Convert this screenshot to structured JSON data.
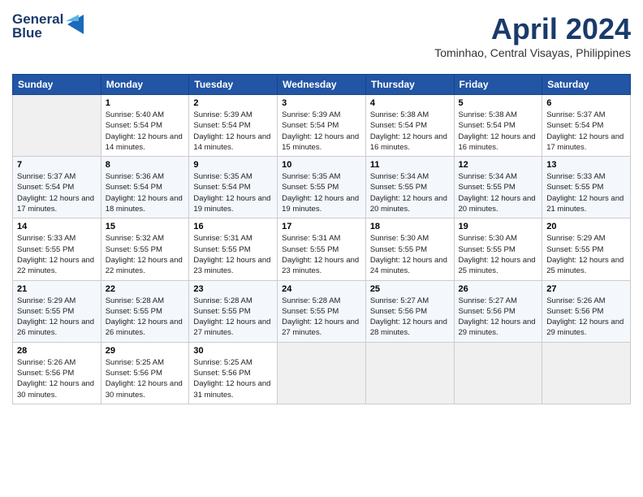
{
  "header": {
    "logo_line1": "General",
    "logo_line2": "Blue",
    "month": "April 2024",
    "location": "Tominhao, Central Visayas, Philippines"
  },
  "weekdays": [
    "Sunday",
    "Monday",
    "Tuesday",
    "Wednesday",
    "Thursday",
    "Friday",
    "Saturday"
  ],
  "weeks": [
    [
      {
        "day": "",
        "sunrise": "",
        "sunset": "",
        "daylight": ""
      },
      {
        "day": "1",
        "sunrise": "Sunrise: 5:40 AM",
        "sunset": "Sunset: 5:54 PM",
        "daylight": "Daylight: 12 hours and 14 minutes."
      },
      {
        "day": "2",
        "sunrise": "Sunrise: 5:39 AM",
        "sunset": "Sunset: 5:54 PM",
        "daylight": "Daylight: 12 hours and 14 minutes."
      },
      {
        "day": "3",
        "sunrise": "Sunrise: 5:39 AM",
        "sunset": "Sunset: 5:54 PM",
        "daylight": "Daylight: 12 hours and 15 minutes."
      },
      {
        "day": "4",
        "sunrise": "Sunrise: 5:38 AM",
        "sunset": "Sunset: 5:54 PM",
        "daylight": "Daylight: 12 hours and 16 minutes."
      },
      {
        "day": "5",
        "sunrise": "Sunrise: 5:38 AM",
        "sunset": "Sunset: 5:54 PM",
        "daylight": "Daylight: 12 hours and 16 minutes."
      },
      {
        "day": "6",
        "sunrise": "Sunrise: 5:37 AM",
        "sunset": "Sunset: 5:54 PM",
        "daylight": "Daylight: 12 hours and 17 minutes."
      }
    ],
    [
      {
        "day": "7",
        "sunrise": "Sunrise: 5:37 AM",
        "sunset": "Sunset: 5:54 PM",
        "daylight": "Daylight: 12 hours and 17 minutes."
      },
      {
        "day": "8",
        "sunrise": "Sunrise: 5:36 AM",
        "sunset": "Sunset: 5:54 PM",
        "daylight": "Daylight: 12 hours and 18 minutes."
      },
      {
        "day": "9",
        "sunrise": "Sunrise: 5:35 AM",
        "sunset": "Sunset: 5:54 PM",
        "daylight": "Daylight: 12 hours and 19 minutes."
      },
      {
        "day": "10",
        "sunrise": "Sunrise: 5:35 AM",
        "sunset": "Sunset: 5:55 PM",
        "daylight": "Daylight: 12 hours and 19 minutes."
      },
      {
        "day": "11",
        "sunrise": "Sunrise: 5:34 AM",
        "sunset": "Sunset: 5:55 PM",
        "daylight": "Daylight: 12 hours and 20 minutes."
      },
      {
        "day": "12",
        "sunrise": "Sunrise: 5:34 AM",
        "sunset": "Sunset: 5:55 PM",
        "daylight": "Daylight: 12 hours and 20 minutes."
      },
      {
        "day": "13",
        "sunrise": "Sunrise: 5:33 AM",
        "sunset": "Sunset: 5:55 PM",
        "daylight": "Daylight: 12 hours and 21 minutes."
      }
    ],
    [
      {
        "day": "14",
        "sunrise": "Sunrise: 5:33 AM",
        "sunset": "Sunset: 5:55 PM",
        "daylight": "Daylight: 12 hours and 22 minutes."
      },
      {
        "day": "15",
        "sunrise": "Sunrise: 5:32 AM",
        "sunset": "Sunset: 5:55 PM",
        "daylight": "Daylight: 12 hours and 22 minutes."
      },
      {
        "day": "16",
        "sunrise": "Sunrise: 5:31 AM",
        "sunset": "Sunset: 5:55 PM",
        "daylight": "Daylight: 12 hours and 23 minutes."
      },
      {
        "day": "17",
        "sunrise": "Sunrise: 5:31 AM",
        "sunset": "Sunset: 5:55 PM",
        "daylight": "Daylight: 12 hours and 23 minutes."
      },
      {
        "day": "18",
        "sunrise": "Sunrise: 5:30 AM",
        "sunset": "Sunset: 5:55 PM",
        "daylight": "Daylight: 12 hours and 24 minutes."
      },
      {
        "day": "19",
        "sunrise": "Sunrise: 5:30 AM",
        "sunset": "Sunset: 5:55 PM",
        "daylight": "Daylight: 12 hours and 25 minutes."
      },
      {
        "day": "20",
        "sunrise": "Sunrise: 5:29 AM",
        "sunset": "Sunset: 5:55 PM",
        "daylight": "Daylight: 12 hours and 25 minutes."
      }
    ],
    [
      {
        "day": "21",
        "sunrise": "Sunrise: 5:29 AM",
        "sunset": "Sunset: 5:55 PM",
        "daylight": "Daylight: 12 hours and 26 minutes."
      },
      {
        "day": "22",
        "sunrise": "Sunrise: 5:28 AM",
        "sunset": "Sunset: 5:55 PM",
        "daylight": "Daylight: 12 hours and 26 minutes."
      },
      {
        "day": "23",
        "sunrise": "Sunrise: 5:28 AM",
        "sunset": "Sunset: 5:55 PM",
        "daylight": "Daylight: 12 hours and 27 minutes."
      },
      {
        "day": "24",
        "sunrise": "Sunrise: 5:28 AM",
        "sunset": "Sunset: 5:55 PM",
        "daylight": "Daylight: 12 hours and 27 minutes."
      },
      {
        "day": "25",
        "sunrise": "Sunrise: 5:27 AM",
        "sunset": "Sunset: 5:56 PM",
        "daylight": "Daylight: 12 hours and 28 minutes."
      },
      {
        "day": "26",
        "sunrise": "Sunrise: 5:27 AM",
        "sunset": "Sunset: 5:56 PM",
        "daylight": "Daylight: 12 hours and 29 minutes."
      },
      {
        "day": "27",
        "sunrise": "Sunrise: 5:26 AM",
        "sunset": "Sunset: 5:56 PM",
        "daylight": "Daylight: 12 hours and 29 minutes."
      }
    ],
    [
      {
        "day": "28",
        "sunrise": "Sunrise: 5:26 AM",
        "sunset": "Sunset: 5:56 PM",
        "daylight": "Daylight: 12 hours and 30 minutes."
      },
      {
        "day": "29",
        "sunrise": "Sunrise: 5:25 AM",
        "sunset": "Sunset: 5:56 PM",
        "daylight": "Daylight: 12 hours and 30 minutes."
      },
      {
        "day": "30",
        "sunrise": "Sunrise: 5:25 AM",
        "sunset": "Sunset: 5:56 PM",
        "daylight": "Daylight: 12 hours and 31 minutes."
      },
      {
        "day": "",
        "sunrise": "",
        "sunset": "",
        "daylight": ""
      },
      {
        "day": "",
        "sunrise": "",
        "sunset": "",
        "daylight": ""
      },
      {
        "day": "",
        "sunrise": "",
        "sunset": "",
        "daylight": ""
      },
      {
        "day": "",
        "sunrise": "",
        "sunset": "",
        "daylight": ""
      }
    ]
  ]
}
